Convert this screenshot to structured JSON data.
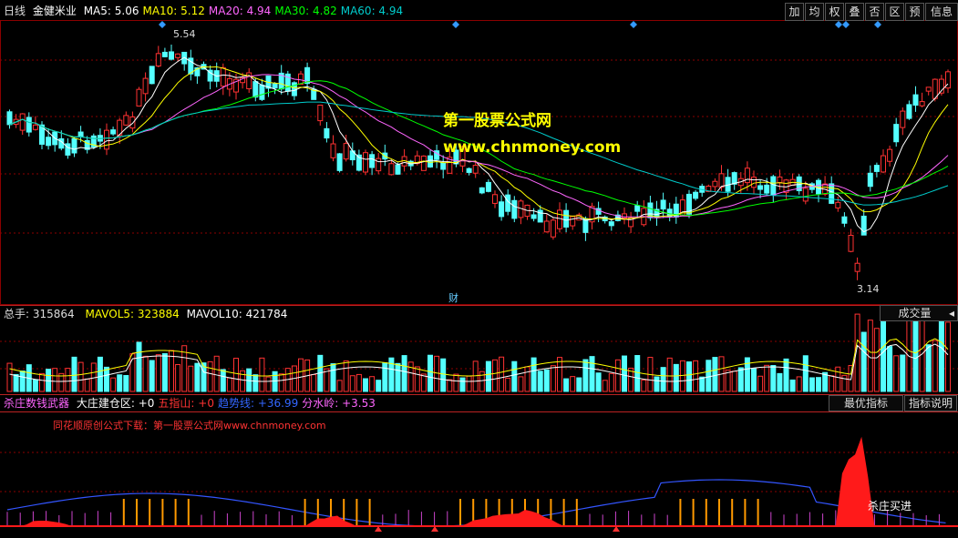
{
  "header": {
    "period": "日线",
    "stock_name": "金健米业",
    "ma": [
      {
        "label": "MA5: 5.06",
        "color": "#ffffff"
      },
      {
        "label": "MA10: 5.12",
        "color": "#ffff00"
      },
      {
        "label": "MA20: 4.94",
        "color": "#ff66ff"
      },
      {
        "label": "MA30: 4.82",
        "color": "#00ff00"
      },
      {
        "label": "MA60: 4.94",
        "color": "#00cccc"
      }
    ]
  },
  "toolbar": [
    "加",
    "均",
    "权",
    "叠",
    "否",
    "区",
    "预",
    "信息"
  ],
  "watermark": {
    "line1": "第一股票公式网",
    "line2": "www.chnmoney.com"
  },
  "price_labels": {
    "high": "5.54",
    "low": "3.14",
    "cai": "财"
  },
  "volume": {
    "total": "总手: 315864",
    "mavol5": "MAVOL5: 323884",
    "mavol10": "MAVOL10: 421784",
    "dropdown": "成交量"
  },
  "indicator": {
    "name": "杀庄数钱武器",
    "values": [
      {
        "label": "大庄建仓区: +0",
        "color": "#ffffff"
      },
      {
        "label": "五指山: +0",
        "color": "#ff3333"
      },
      {
        "label": "趋势线: +36.99",
        "color": "#3366ff"
      },
      {
        "label": "分水岭: +3.53",
        "color": "#ff66ff"
      }
    ],
    "best_button": "最优指标",
    "explain_button": "指标说明",
    "promo": "同花顺原创公式下载：第一股票公式网www.chnmoney.com",
    "signal": "杀庄买进"
  },
  "colors": {
    "up": "#ff3232",
    "down": "#54ffff",
    "grid": "#8b0000"
  }
}
